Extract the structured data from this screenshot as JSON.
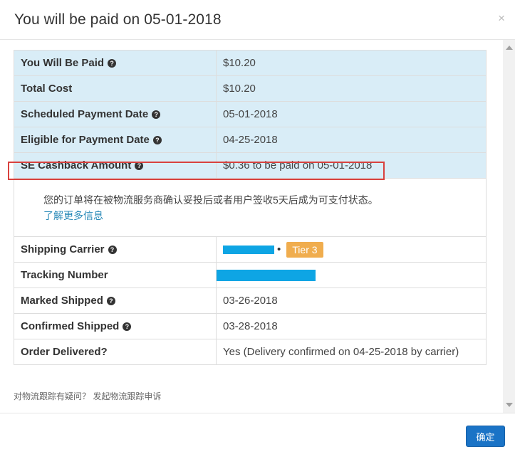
{
  "modal": {
    "title": "You will be paid on 05-01-2018",
    "close_label": "×",
    "confirm_label": "确定",
    "footer_link": "对物流跟踪有疑问？ 发起物流跟踪申诉"
  },
  "payment": {
    "you_will_be_paid": {
      "label": "You Will Be Paid",
      "value": "$10.20"
    },
    "total_cost": {
      "label": "Total Cost",
      "value": "$10.20"
    },
    "scheduled_payment_date": {
      "label": "Scheduled Payment Date",
      "value": "05-01-2018"
    },
    "eligible_payment_date": {
      "label": "Eligible for Payment Date",
      "value": "04-25-2018"
    },
    "se_cashback": {
      "label": "SE Cashback Amount",
      "value": "$0.36 to be paid on 05-01-2018"
    }
  },
  "note": {
    "text": "您的订单将在被物流服务商确认妥投后或者用户签收5天后成为可支付状态。",
    "link": "了解更多信息"
  },
  "shipping": {
    "carrier": {
      "label": "Shipping Carrier",
      "tier": "Tier 3",
      "separator": "•"
    },
    "tracking": {
      "label": "Tracking Number"
    },
    "marked_shipped": {
      "label": "Marked Shipped",
      "value": "03-26-2018"
    },
    "confirmed_shipped": {
      "label": "Confirmed Shipped",
      "value": "03-28-2018"
    },
    "order_delivered": {
      "label": "Order Delivered?",
      "value": "Yes (Delivery confirmed on 04-25-2018 by carrier)"
    }
  },
  "icons": {
    "help": "question-circle-icon",
    "help_glyph": "?"
  },
  "colors": {
    "highlight_bg": "#d9edf7",
    "redacted_bar": "#0ea5e4",
    "tier_badge": "#f0ad4e",
    "primary_button": "#1a73c6",
    "annotation_box": "#d9413e"
  }
}
